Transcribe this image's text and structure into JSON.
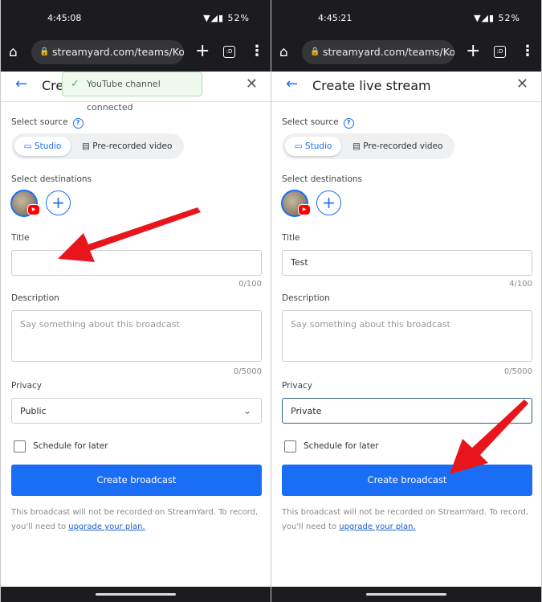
{
  "panels": [
    {
      "status": {
        "time": "4:45:08",
        "icons": "▼◢▮ 52%"
      },
      "browser": {
        "url": "streamyard.com/teams/KoOiu"
      },
      "header": {
        "title": "Create live stream",
        "toast": "YouTube channel connected"
      },
      "form": {
        "select_source": "Select source",
        "source_options": [
          "Studio",
          "Pre-recorded video"
        ],
        "select_destinations": "Select destinations",
        "title_label": "Title",
        "title_value": "",
        "title_count": "0/100",
        "description_label": "Description",
        "description_placeholder": "Say something about this broadcast",
        "description_count": "0/5000",
        "privacy_label": "Privacy",
        "privacy_value": "Public",
        "schedule_label": "Schedule for later",
        "create_button": "Create broadcast",
        "note": "This broadcast will not be recorded on StreamYard. To record, you'll need to ",
        "note_link": "upgrade your plan."
      }
    },
    {
      "status": {
        "time": "4:45:21",
        "icons": "▼◢▮ 52%"
      },
      "browser": {
        "url": "streamyard.com/teams/KoOiu"
      },
      "header": {
        "title": "Create live stream",
        "toast": ""
      },
      "form": {
        "select_source": "Select source",
        "source_options": [
          "Studio",
          "Pre-recorded video"
        ],
        "select_destinations": "Select destinations",
        "title_label": "Title",
        "title_value": "Test",
        "title_count": "4/100",
        "description_label": "Description",
        "description_placeholder": "Say something about this broadcast",
        "description_count": "0/5000",
        "privacy_label": "Privacy",
        "privacy_value": "Private",
        "schedule_label": "Schedule for later",
        "create_button": "Create broadcast",
        "note": "This broadcast will not be recorded on StreamYard. To record, you'll need to ",
        "note_link": "upgrade your plan."
      }
    }
  ],
  "colors": {
    "accent": "#1a6ef5",
    "annotation_arrow": "#e8161c",
    "toast_bg": "#eef8ee"
  }
}
